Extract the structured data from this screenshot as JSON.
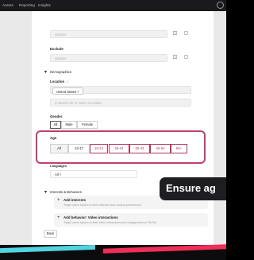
{
  "topbar": {
    "nav": [
      "Assets",
      "Reporting",
      "Insights"
    ]
  },
  "form": {
    "include_placeholder": "Options",
    "exclude_label": "Exclude",
    "exclude_placeholder": "Options",
    "demographics_label": "Demographics",
    "location_label": "Location",
    "location_chip": "United States ×",
    "location_search_placeholder": "Search for or select a location",
    "gender_label": "Gender",
    "gender_options": [
      "All",
      "Male",
      "Female"
    ],
    "age_label": "Age",
    "age_options": [
      "All",
      "13-17",
      "18-24",
      "25-34",
      "35-44",
      "45-54",
      "55+"
    ],
    "languages_label": "Languages",
    "languages_value": "All ×",
    "interests_label": "Interests & Behaviors",
    "add_interests_title": "Add interests",
    "add_interests_desc": "Target users based on their interests and content preferences",
    "add_video_title": "Add behavior: Video interactions",
    "add_video_desc": "Target users based on their video interactions and engagement on TikTok",
    "back_label": "Back"
  },
  "caption": {
    "text": "Ensure ag"
  },
  "colors": {
    "highlight": "#c23f6c",
    "caption_bg": "#1e1e22",
    "brand_cyan": "#52d4e0",
    "brand_red": "#ee2f58"
  }
}
